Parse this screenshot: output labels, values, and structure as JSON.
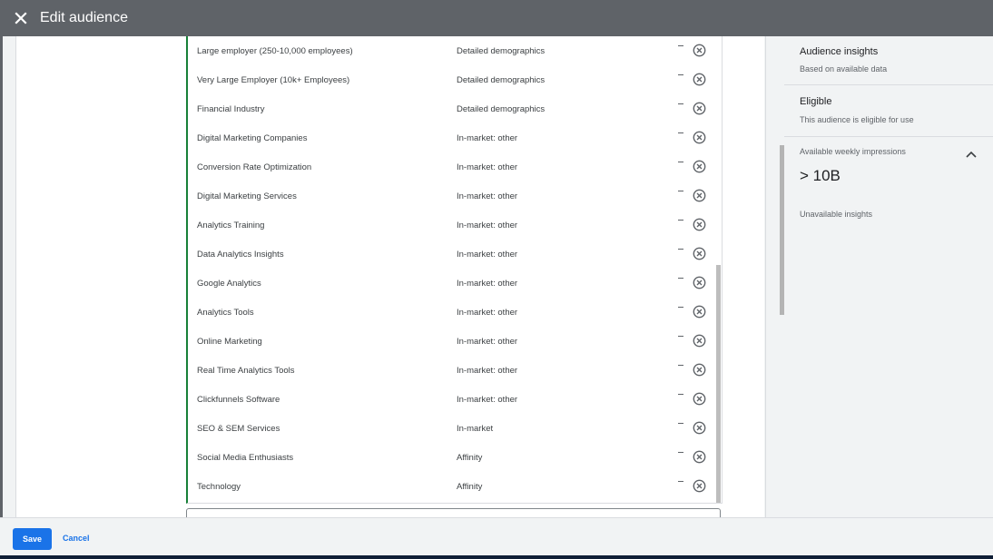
{
  "header": {
    "title": "Edit audience",
    "close_icon": "close-icon"
  },
  "segments": [
    {
      "name": "Large employer (250-10,000 employees)",
      "category": "Detailed demographics"
    },
    {
      "name": "Very Large Employer (10k+ Employees)",
      "category": "Detailed demographics"
    },
    {
      "name": "Financial Industry",
      "category": "Detailed demographics"
    },
    {
      "name": "Digital Marketing Companies",
      "category": "In-market: other"
    },
    {
      "name": "Conversion Rate Optimization",
      "category": "In-market: other"
    },
    {
      "name": "Digital Marketing Services",
      "category": "In-market: other"
    },
    {
      "name": "Analytics Training",
      "category": "In-market: other"
    },
    {
      "name": "Data Analytics Insights",
      "category": "In-market: other"
    },
    {
      "name": "Google Analytics",
      "category": "In-market: other"
    },
    {
      "name": "Analytics Tools",
      "category": "In-market: other"
    },
    {
      "name": "Online Marketing",
      "category": "In-market: other"
    },
    {
      "name": "Real Time Analytics Tools",
      "category": "In-market: other"
    },
    {
      "name": "Clickfunnels Software",
      "category": "In-market: other"
    },
    {
      "name": "SEO & SEM Services",
      "category": "In-market"
    },
    {
      "name": "Social Media Enthusiasts",
      "category": "Affinity"
    },
    {
      "name": "Technology",
      "category": "Affinity"
    }
  ],
  "row_icons": {
    "minus": "minus-icon",
    "remove": "remove-circle-icon"
  },
  "sidebar": {
    "insights_title": "Audience insights",
    "insights_subtitle": "Based on available data",
    "eligible_title": "Eligible",
    "eligible_subtitle": "This audience is eligible for use",
    "impressions_label": "Available weekly impressions",
    "impressions_value": "> 10B",
    "unavailable": "Unavailable insights"
  },
  "footer": {
    "save_label": "Save",
    "cancel_label": "Cancel"
  },
  "colors": {
    "accent": "#1a73e8",
    "header": "#5f6368",
    "included_border": "#188038"
  }
}
